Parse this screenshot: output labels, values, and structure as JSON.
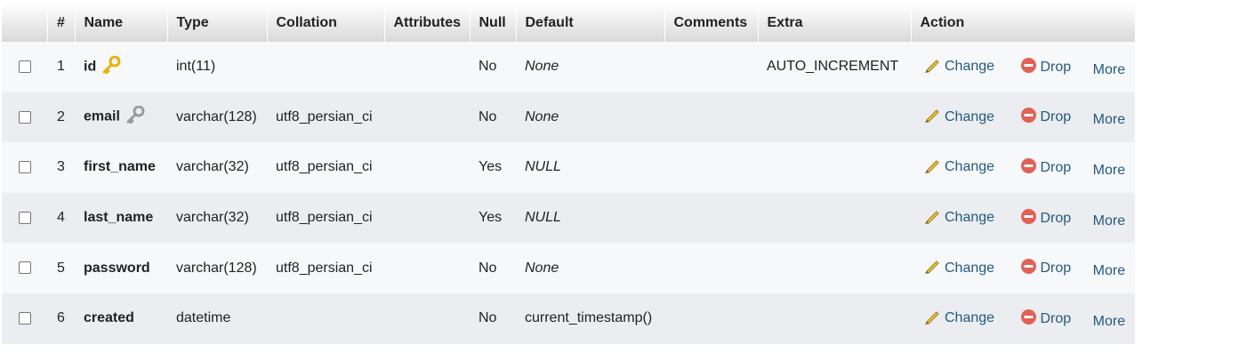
{
  "columns": [
    "#",
    "Name",
    "Type",
    "Collation",
    "Attributes",
    "Null",
    "Default",
    "Comments",
    "Extra",
    "Action"
  ],
  "actions": {
    "change": "Change",
    "drop": "Drop",
    "more": "More"
  },
  "rows": [
    {
      "num": "1",
      "name": "id",
      "key": "primary",
      "type": "int(11)",
      "collation": "",
      "attributes": "",
      "null": "No",
      "default": "None",
      "default_italic": true,
      "comments": "",
      "extra": "AUTO_INCREMENT"
    },
    {
      "num": "2",
      "name": "email",
      "key": "unique",
      "type": "varchar(128)",
      "collation": "utf8_persian_ci",
      "attributes": "",
      "null": "No",
      "default": "None",
      "default_italic": true,
      "comments": "",
      "extra": ""
    },
    {
      "num": "3",
      "name": "first_name",
      "key": "",
      "type": "varchar(32)",
      "collation": "utf8_persian_ci",
      "attributes": "",
      "null": "Yes",
      "default": "NULL",
      "default_italic": true,
      "comments": "",
      "extra": ""
    },
    {
      "num": "4",
      "name": "last_name",
      "key": "",
      "type": "varchar(32)",
      "collation": "utf8_persian_ci",
      "attributes": "",
      "null": "Yes",
      "default": "NULL",
      "default_italic": true,
      "comments": "",
      "extra": ""
    },
    {
      "num": "5",
      "name": "password",
      "key": "",
      "type": "varchar(128)",
      "collation": "utf8_persian_ci",
      "attributes": "",
      "null": "No",
      "default": "None",
      "default_italic": true,
      "comments": "",
      "extra": ""
    },
    {
      "num": "6",
      "name": "created",
      "key": "",
      "type": "datetime",
      "collation": "",
      "attributes": "",
      "null": "No",
      "default": "current_timestamp()",
      "default_italic": false,
      "comments": "",
      "extra": ""
    }
  ],
  "colors": {
    "link": "#235a81",
    "drop_icon": "#e06155",
    "primary_key_icon": "#e8b10e",
    "unique_key_icon": "#9a9a9a"
  }
}
